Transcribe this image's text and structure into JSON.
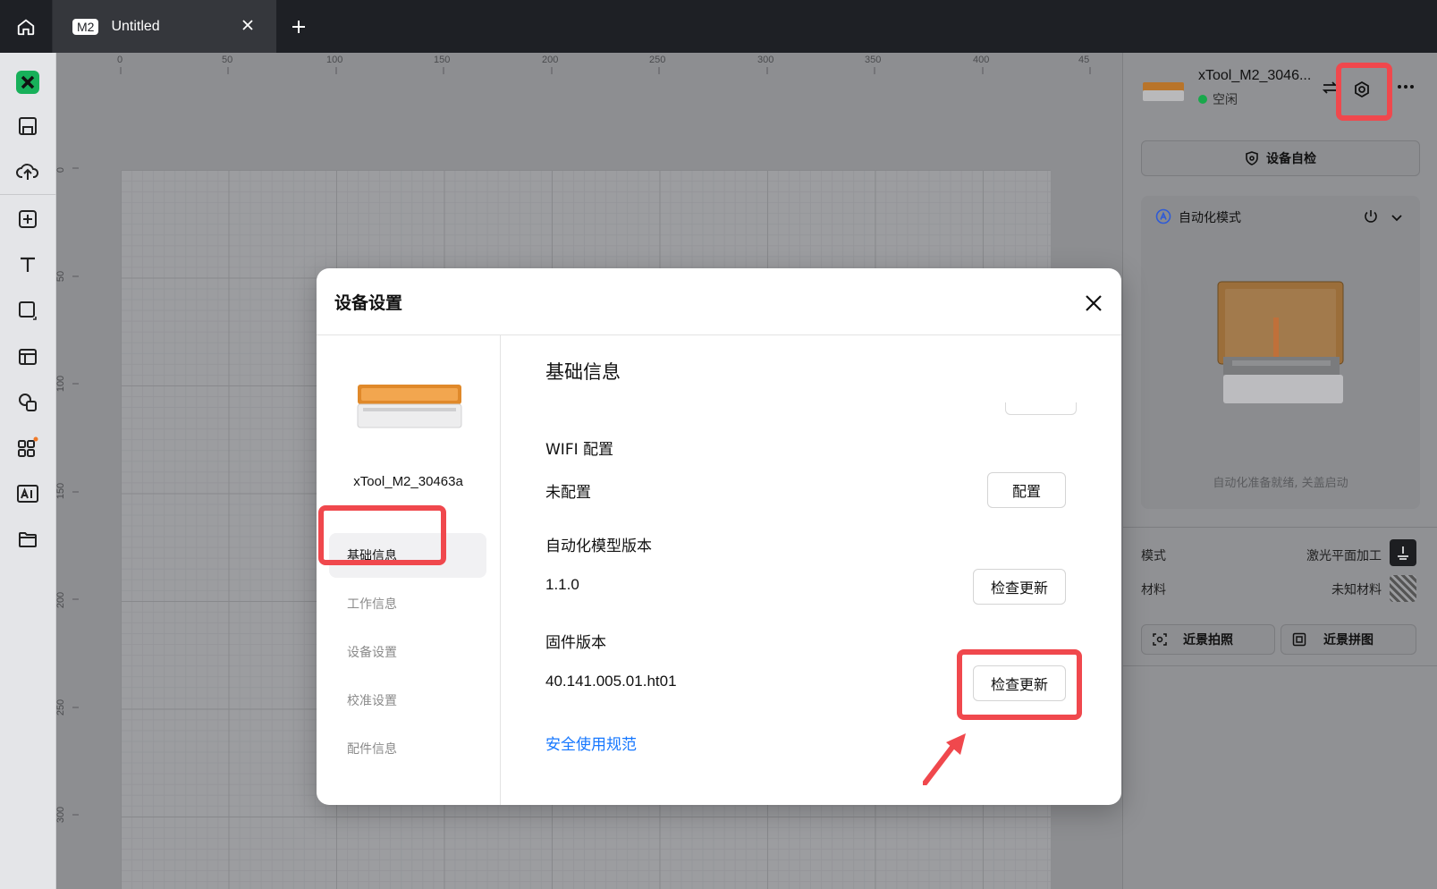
{
  "topbar": {
    "tab_badge": "M2",
    "tab_title": "Untitled"
  },
  "ruler": {
    "top": [
      "0",
      "50",
      "100",
      "150",
      "200",
      "250",
      "300",
      "350",
      "400",
      "45"
    ],
    "left": [
      "0",
      "50",
      "100",
      "150",
      "200",
      "250",
      "300"
    ]
  },
  "right_panel": {
    "device_name": "xTool_M2_3046...",
    "status": "空闲",
    "self_check": "设备自检",
    "automation_title": "自动化模式",
    "automation_caption": "自动化准备就绪, 关盖启动",
    "mode_label": "模式",
    "mode_value": "激光平面加工",
    "material_label": "材料",
    "material_value": "未知材料",
    "photo_button": "近景拍照",
    "stitch_button": "近景拼图"
  },
  "dialog": {
    "title": "设备设置",
    "device_name": "xTool_M2_30463a",
    "nav": [
      "基础信息",
      "工作信息",
      "设备设置",
      "校准设置",
      "配件信息"
    ],
    "section_title": "基础信息",
    "wifi_label": "WIFI 配置",
    "wifi_value": "未配置",
    "wifi_button": "配置",
    "model_label": "自动化模型版本",
    "model_value": "1.1.0",
    "model_button": "检查更新",
    "firmware_label": "固件版本",
    "firmware_value": "40.141.005.01.ht01",
    "firmware_button": "检查更新",
    "safety_link": "安全使用规范"
  },
  "colors": {
    "highlight": "#f0484d",
    "link": "#1677ff",
    "status_dot": "#19a84b",
    "device_orange": "#e0892a"
  }
}
